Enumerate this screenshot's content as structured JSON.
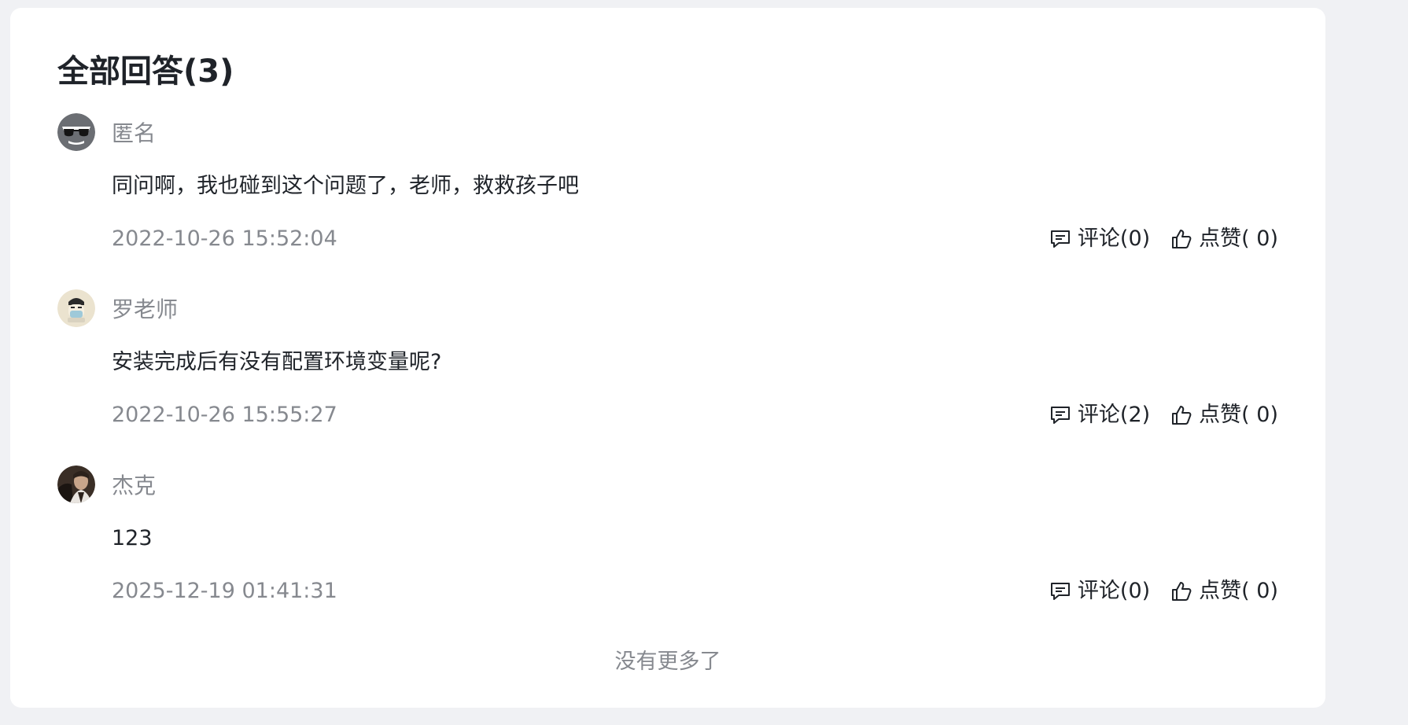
{
  "section": {
    "title": "全部回答(3)"
  },
  "answers": [
    {
      "username": "匿名",
      "avatar_icon": "anonymous-sunglasses-avatar",
      "content": "同问啊，我也碰到这个问题了，老师，救救孩子吧",
      "time": "2022-10-26 15:52:04",
      "comment_label": "评论(0)",
      "like_label": "点赞( 0)"
    },
    {
      "username": "罗老师",
      "avatar_icon": "cartoon-face-avatar",
      "content": "安装完成后有没有配置环境变量呢?",
      "time": "2022-10-26 15:55:27",
      "comment_label": "评论(2)",
      "like_label": "点赞( 0)"
    },
    {
      "username": "杰克",
      "avatar_icon": "photo-avatar",
      "content": "123",
      "time": "2025-12-19 01:41:31",
      "comment_label": "评论(0)",
      "like_label": "点赞( 0)"
    }
  ],
  "footer": {
    "no_more": "没有更多了"
  },
  "colors": {
    "page_bg": "#f0f1f4",
    "card_bg": "#ffffff",
    "text_primary": "#1f2329",
    "text_secondary": "#86898f"
  }
}
